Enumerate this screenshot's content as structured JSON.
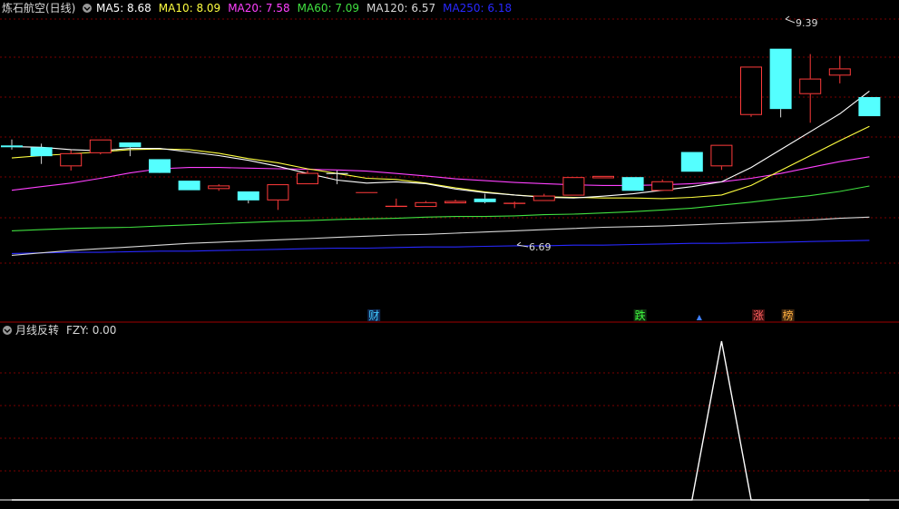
{
  "colors": {
    "background": "#000000",
    "grid": "#7a0000",
    "separator": "#a00000",
    "up_candle": "#ff3b3b",
    "down_candle": "#54ffff",
    "ma5": "#ffffff",
    "ma10": "#ffff40",
    "ma20": "#ff40ff",
    "ma60": "#40e040",
    "ma120": "#d8d8d8",
    "ma250": "#2828ff",
    "fzy": "#ffffff"
  },
  "header": {
    "stock_title": "炼石航空(日线)",
    "collapse_icon": "chevron-down-icon",
    "ma_items": [
      {
        "key": "ma5",
        "text": "MA5: 8.68",
        "color": "#ffffff"
      },
      {
        "key": "ma10",
        "text": "MA10: 8.09",
        "color": "#ffff40"
      },
      {
        "key": "ma20",
        "text": "MA20: 7.58",
        "color": "#ff40ff"
      },
      {
        "key": "ma60",
        "text": "MA60: 7.09",
        "color": "#40e040"
      },
      {
        "key": "ma120",
        "text": "MA120: 6.57",
        "color": "#d8d8d8"
      },
      {
        "key": "ma250",
        "text": "MA250: 6.18",
        "color": "#2828ff"
      }
    ]
  },
  "indicator_header": {
    "name": "月线反转",
    "value_text": "FZY: 0.00",
    "collapse_icon": "chevron-down-icon"
  },
  "event_markers": [
    {
      "label": "财",
      "color": "#40c8ff",
      "bg": "#102850",
      "index": 12
    },
    {
      "label": "跌",
      "color": "#40ff40",
      "bg": "#103010",
      "index": 21
    },
    {
      "label": "▲",
      "color": "#4080ff",
      "bg": "#000000",
      "index": 23,
      "small": true
    },
    {
      "label": "涨",
      "color": "#ff6060",
      "bg": "#401010",
      "index": 25
    },
    {
      "label": "榜",
      "color": "#ffb040",
      "bg": "#402810",
      "index": 26
    }
  ],
  "chart_data": {
    "type": "candlestick",
    "price_range": [
      5.1,
      9.75
    ],
    "annotations": {
      "high_label": "9.39",
      "low_label": "6.69"
    },
    "candles": [
      {
        "o": 7.77,
        "h": 7.87,
        "l": 7.7,
        "c": 7.74
      },
      {
        "o": 7.74,
        "h": 7.8,
        "l": 7.46,
        "c": 7.59
      },
      {
        "o": 7.42,
        "h": 7.69,
        "l": 7.35,
        "c": 7.64
      },
      {
        "o": 7.64,
        "h": 7.87,
        "l": 7.62,
        "c": 7.87
      },
      {
        "o": 7.82,
        "h": 7.82,
        "l": 7.59,
        "c": 7.74
      },
      {
        "o": 7.54,
        "h": 7.54,
        "l": 7.32,
        "c": 7.31
      },
      {
        "o": 7.18,
        "h": 7.18,
        "l": 7.02,
        "c": 7.02
      },
      {
        "o": 7.04,
        "h": 7.12,
        "l": 7.01,
        "c": 7.1
      },
      {
        "o": 7.0,
        "h": 7.0,
        "l": 6.8,
        "c": 6.85
      },
      {
        "o": 6.85,
        "h": 7.12,
        "l": 6.69,
        "c": 7.12
      },
      {
        "o": 7.12,
        "h": 7.35,
        "l": 7.12,
        "c": 7.31
      },
      {
        "o": 7.3,
        "h": 7.35,
        "l": 7.12,
        "c": 7.29
      },
      {
        "o": 6.98,
        "h": 6.98,
        "l": 6.98,
        "c": 6.98
      },
      {
        "o": 6.74,
        "h": 6.88,
        "l": 6.74,
        "c": 6.76
      },
      {
        "o": 6.74,
        "h": 6.84,
        "l": 6.74,
        "c": 6.82
      },
      {
        "o": 6.8,
        "h": 6.86,
        "l": 6.8,
        "c": 6.84
      },
      {
        "o": 6.88,
        "h": 6.96,
        "l": 6.8,
        "c": 6.82
      },
      {
        "o": 6.79,
        "h": 6.83,
        "l": 6.72,
        "c": 6.81
      },
      {
        "o": 6.84,
        "h": 6.96,
        "l": 6.84,
        "c": 6.93
      },
      {
        "o": 6.93,
        "h": 7.24,
        "l": 6.93,
        "c": 7.24
      },
      {
        "o": 7.22,
        "h": 7.26,
        "l": 7.22,
        "c": 7.26
      },
      {
        "o": 7.24,
        "h": 7.24,
        "l": 7.01,
        "c": 7.01
      },
      {
        "o": 7.01,
        "h": 7.2,
        "l": 7.01,
        "c": 7.17
      },
      {
        "o": 7.66,
        "h": 7.66,
        "l": 7.33,
        "c": 7.33
      },
      {
        "o": 7.42,
        "h": 7.78,
        "l": 7.36,
        "c": 7.78
      },
      {
        "o": 8.28,
        "h": 9.09,
        "l": 8.25,
        "c": 9.09
      },
      {
        "o": 9.39,
        "h": 9.39,
        "l": 8.24,
        "c": 8.38
      },
      {
        "o": 8.63,
        "h": 9.3,
        "l": 8.15,
        "c": 8.89
      },
      {
        "o": 8.94,
        "h": 9.27,
        "l": 8.81,
        "c": 9.06
      },
      {
        "o": 8.58,
        "h": 8.58,
        "l": 8.26,
        "c": 8.26
      }
    ],
    "ma": {
      "ma5": [
        7.75,
        7.74,
        7.7,
        7.68,
        7.72,
        7.72,
        7.66,
        7.6,
        7.52,
        7.42,
        7.3,
        7.19,
        7.14,
        7.16,
        7.13,
        7.04,
        6.98,
        6.94,
        6.9,
        6.89,
        6.92,
        6.96,
        7.02,
        7.08,
        7.16,
        7.4,
        7.7,
        8.0,
        8.3,
        8.68
      ],
      "ma10": [
        7.56,
        7.6,
        7.63,
        7.66,
        7.7,
        7.71,
        7.7,
        7.64,
        7.55,
        7.48,
        7.38,
        7.3,
        7.22,
        7.2,
        7.14,
        7.06,
        6.99,
        6.94,
        6.91,
        6.9,
        6.89,
        6.89,
        6.88,
        6.9,
        6.94,
        7.1,
        7.35,
        7.6,
        7.85,
        8.09
      ],
      "ma20": [
        7.02,
        7.08,
        7.14,
        7.22,
        7.31,
        7.38,
        7.4,
        7.4,
        7.39,
        7.38,
        7.37,
        7.36,
        7.34,
        7.3,
        7.26,
        7.21,
        7.18,
        7.15,
        7.13,
        7.11,
        7.1,
        7.1,
        7.11,
        7.13,
        7.16,
        7.22,
        7.3,
        7.4,
        7.5,
        7.58
      ],
      "ma60": [
        6.34,
        6.36,
        6.38,
        6.39,
        6.4,
        6.42,
        6.44,
        6.46,
        6.48,
        6.5,
        6.51,
        6.53,
        6.54,
        6.55,
        6.57,
        6.58,
        6.58,
        6.59,
        6.61,
        6.62,
        6.64,
        6.66,
        6.69,
        6.72,
        6.77,
        6.82,
        6.88,
        6.93,
        7.0,
        7.09
      ],
      "ma120": [
        5.93,
        5.97,
        6.01,
        6.04,
        6.07,
        6.1,
        6.13,
        6.15,
        6.17,
        6.19,
        6.21,
        6.23,
        6.25,
        6.27,
        6.28,
        6.3,
        6.32,
        6.34,
        6.36,
        6.38,
        6.4,
        6.41,
        6.42,
        6.44,
        6.46,
        6.48,
        6.5,
        6.52,
        6.55,
        6.57
      ],
      "ma250": [
        5.96,
        5.97,
        5.98,
        5.98,
        5.99,
        6.0,
        6.0,
        6.01,
        6.02,
        6.03,
        6.04,
        6.05,
        6.05,
        6.06,
        6.07,
        6.07,
        6.08,
        6.09,
        6.09,
        6.1,
        6.1,
        6.11,
        6.12,
        6.13,
        6.13,
        6.14,
        6.15,
        6.16,
        6.17,
        6.18
      ]
    },
    "fzy": {
      "name": "FZY",
      "range": [
        0,
        1
      ],
      "values": [
        0,
        0,
        0,
        0,
        0,
        0,
        0,
        0,
        0,
        0,
        0,
        0,
        0,
        0,
        0,
        0,
        0,
        0,
        0,
        0,
        0,
        0,
        0,
        0,
        1,
        0,
        0,
        0,
        0,
        0
      ]
    }
  }
}
